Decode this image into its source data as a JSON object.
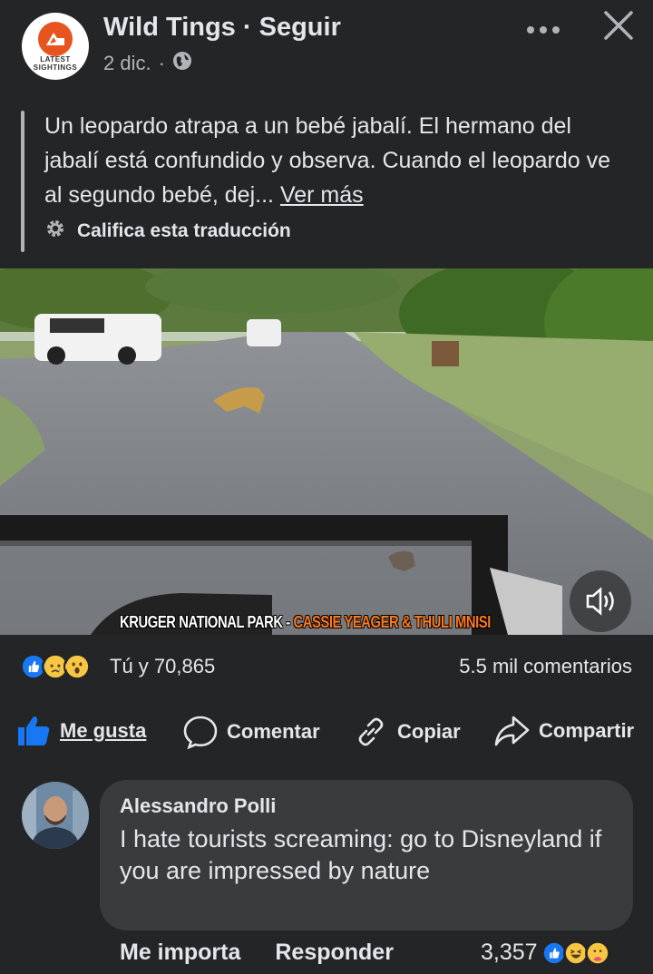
{
  "post": {
    "page_name": "Wild Tings",
    "follow_label": "Seguir",
    "date": "2 dic.",
    "dot": "·",
    "avatar_text": "LATEST SIGHTINGS",
    "more_icon": "more-dots-icon",
    "close_icon": "close-icon",
    "text": "Un leopardo atrapa a un bebé jabalí. El hermano del jabalí está confundido y observa. Cuando el leopardo ve al segundo bebé, dej...",
    "see_more": "Ver más",
    "rate_translation": "Califica esta traducción"
  },
  "video": {
    "caption_white": "KRUGER NATIONAL PARK - ",
    "caption_orange": "CASSIE YEAGER & THULI MNISI",
    "sound_icon": "speaker-icon"
  },
  "reactions": {
    "summary": "Tú y 70,865",
    "comments": "5.5 mil comentarios",
    "icons": [
      "like-reaction-icon",
      "sad-reaction-icon",
      "wow-reaction-icon"
    ]
  },
  "actions": {
    "like": "Me gusta",
    "comment": "Comentar",
    "copy": "Copiar",
    "share": "Compartir"
  },
  "comment": {
    "author": "Alessandro Polli",
    "text": "I hate tourists screaming: go to Disneyland if you are impressed by nature",
    "love_label": "Me importa",
    "reply_label": "Responder",
    "reaction_count": "3,357",
    "icons": [
      "like-reaction-icon",
      "haha-reaction-icon",
      "care-reaction-icon"
    ]
  },
  "colors": {
    "background": "#242526",
    "bubble": "#3a3b3c",
    "like_blue": "#1877f2",
    "caption_orange": "#ff7a1a"
  }
}
